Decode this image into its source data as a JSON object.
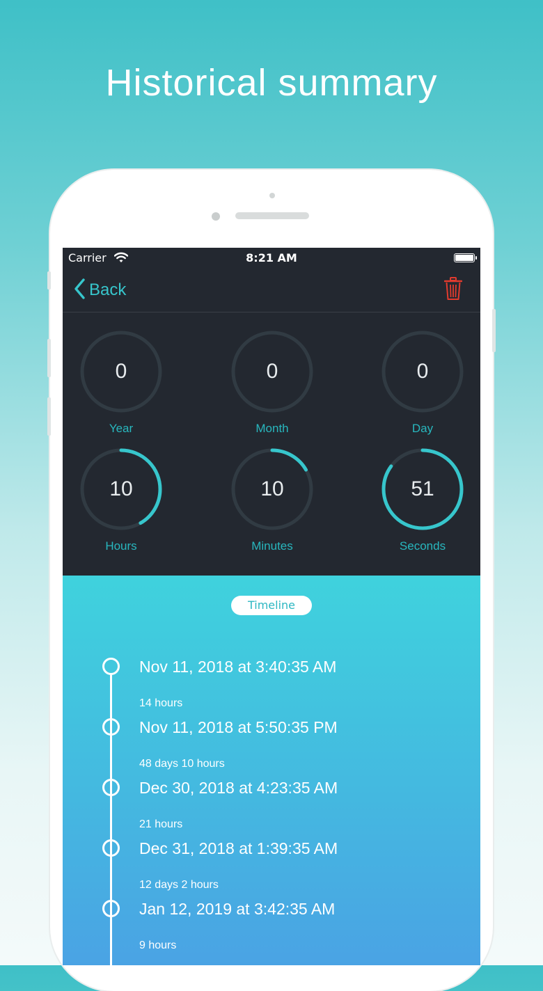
{
  "headline": "Historical summary",
  "status_bar": {
    "carrier": "Carrier",
    "time": "8:21 AM"
  },
  "nav": {
    "back_label": "Back"
  },
  "dials": [
    {
      "value": "0",
      "label": "Year",
      "progress": 0
    },
    {
      "value": "0",
      "label": "Month",
      "progress": 0
    },
    {
      "value": "0",
      "label": "Day",
      "progress": 0
    },
    {
      "value": "10",
      "label": "Hours",
      "progress": 0.4167
    },
    {
      "value": "10",
      "label": "Minutes",
      "progress": 0.1667
    },
    {
      "value": "51",
      "label": "Seconds",
      "progress": 0.85
    }
  ],
  "timeline": {
    "pill_label": "Timeline",
    "entries": [
      {
        "date": "Nov 11, 2018 at 3:40:35 AM",
        "gap_after": "14 hours"
      },
      {
        "date": "Nov 11, 2018 at 5:50:35 PM",
        "gap_after": "48 days 10 hours"
      },
      {
        "date": "Dec 30, 2018 at 4:23:35 AM",
        "gap_after": "21 hours"
      },
      {
        "date": "Dec 31, 2018 at 1:39:35 AM",
        "gap_after": "12 days 2 hours"
      },
      {
        "date": "Jan 12, 2019 at 3:42:35 AM",
        "gap_after": "9 hours"
      }
    ]
  },
  "colors": {
    "accent": "#37c6cc",
    "track": "#313b43",
    "delete": "#e23b2e"
  },
  "icons": {
    "back": "chevron-left-icon",
    "delete": "trash-icon",
    "wifi": "wifi-icon",
    "battery": "battery-icon"
  }
}
